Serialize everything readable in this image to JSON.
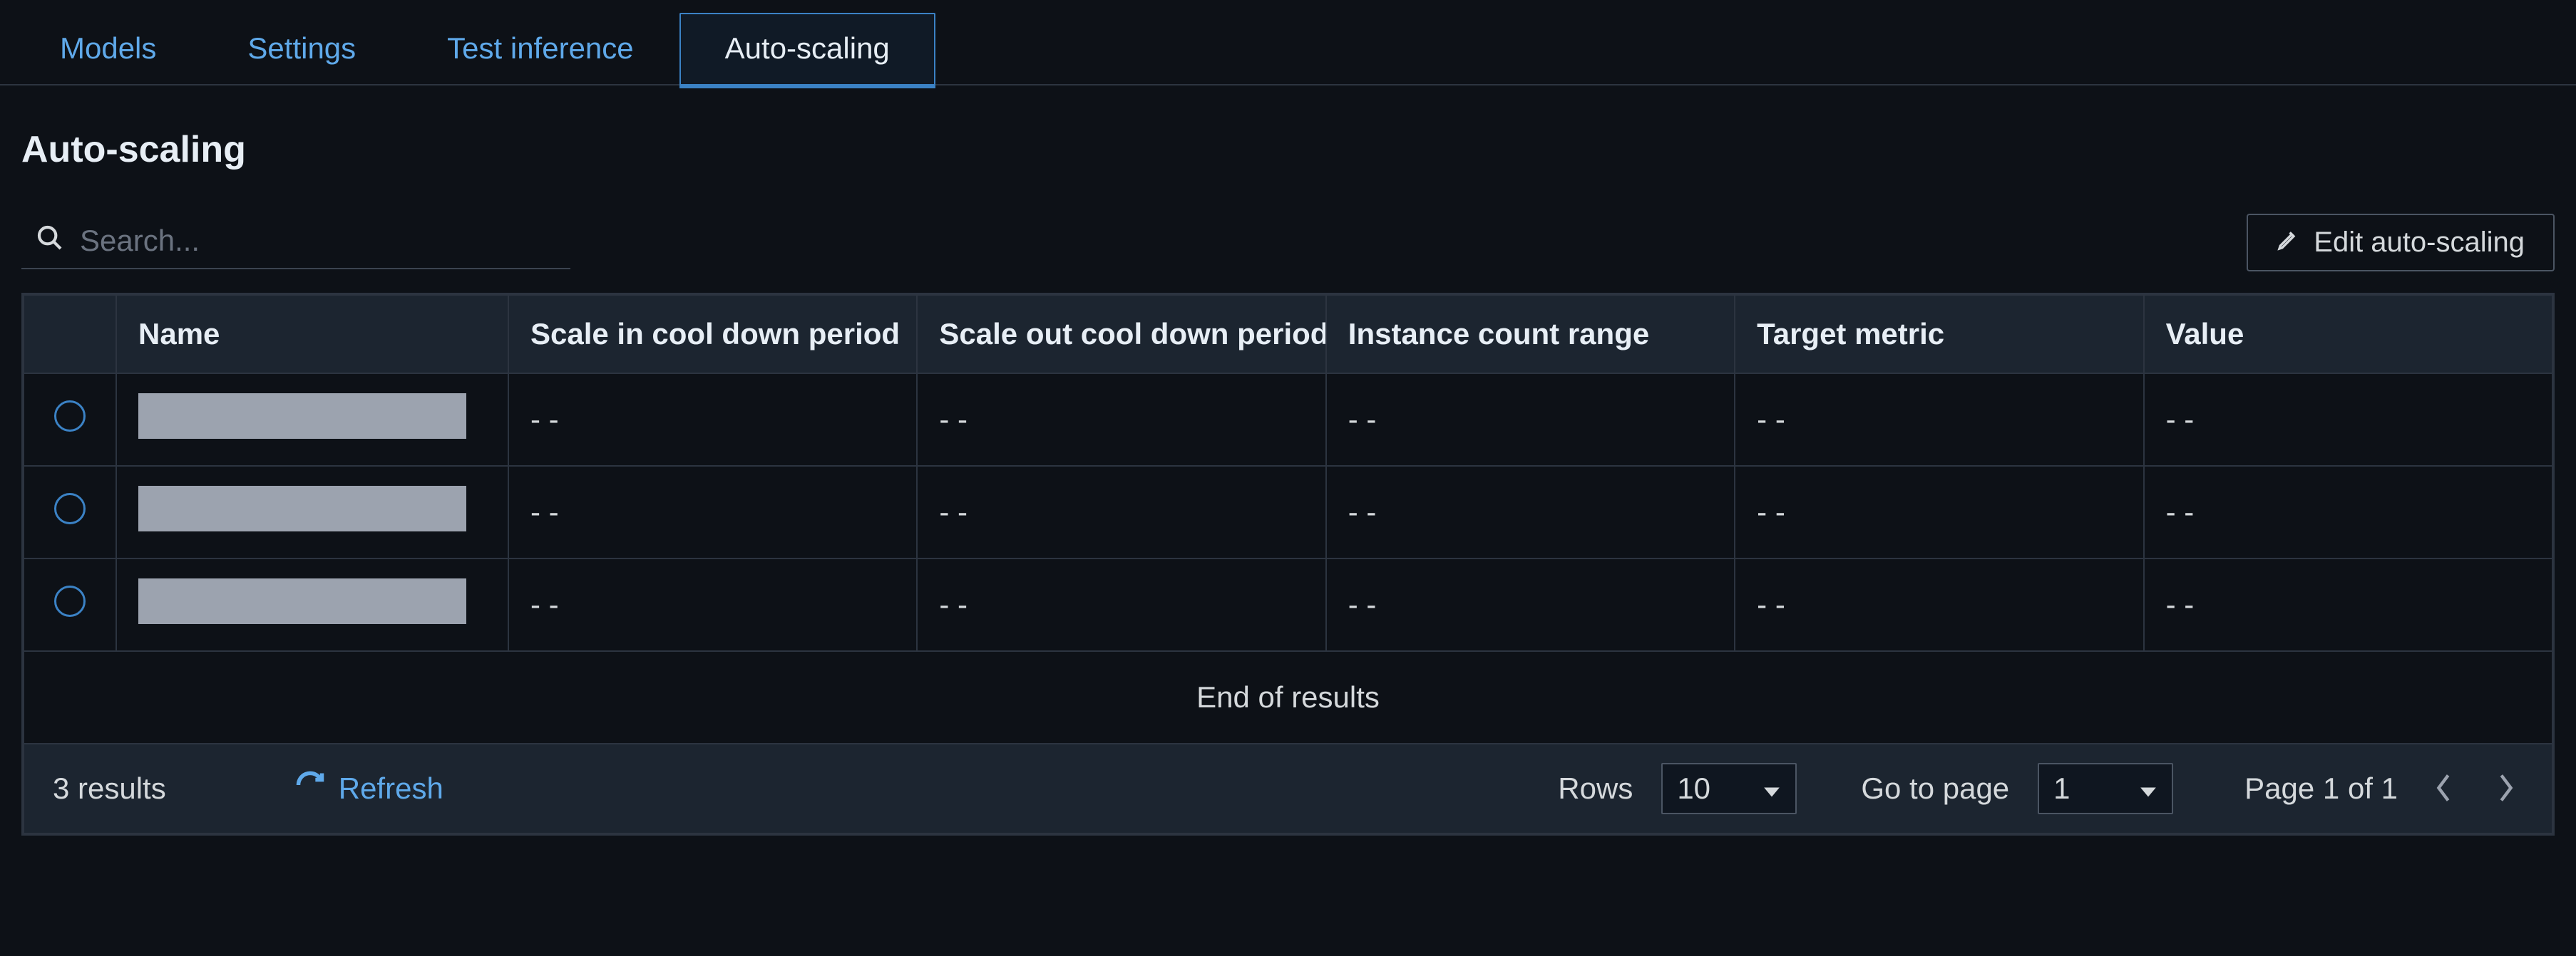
{
  "tabs": [
    {
      "label": "Models",
      "active": false
    },
    {
      "label": "Settings",
      "active": false
    },
    {
      "label": "Test inference",
      "active": false
    },
    {
      "label": "Auto-scaling",
      "active": true
    }
  ],
  "page": {
    "title": "Auto-scaling"
  },
  "search": {
    "placeholder": "Search..."
  },
  "buttons": {
    "edit": "Edit auto-scaling",
    "refresh": "Refresh"
  },
  "table": {
    "columns": [
      "Name",
      "Scale in cool down period",
      "Scale out cool down period",
      "Instance count range",
      "Target metric",
      "Value"
    ],
    "rows": [
      {
        "name": "",
        "scale_in": "- -",
        "scale_out": "- -",
        "range": "- -",
        "metric": "- -",
        "value": "- -"
      },
      {
        "name": "",
        "scale_in": "- -",
        "scale_out": "- -",
        "range": "- -",
        "metric": "- -",
        "value": "- -"
      },
      {
        "name": "",
        "scale_in": "- -",
        "scale_out": "- -",
        "range": "- -",
        "metric": "- -",
        "value": "- -"
      }
    ],
    "end_of_results": "End of results"
  },
  "footer": {
    "results_count": "3 results",
    "rows_label": "Rows",
    "rows_value": "10",
    "go_to_page_label": "Go to page",
    "go_to_page_value": "1",
    "page_indicator": "Page 1 of 1"
  }
}
